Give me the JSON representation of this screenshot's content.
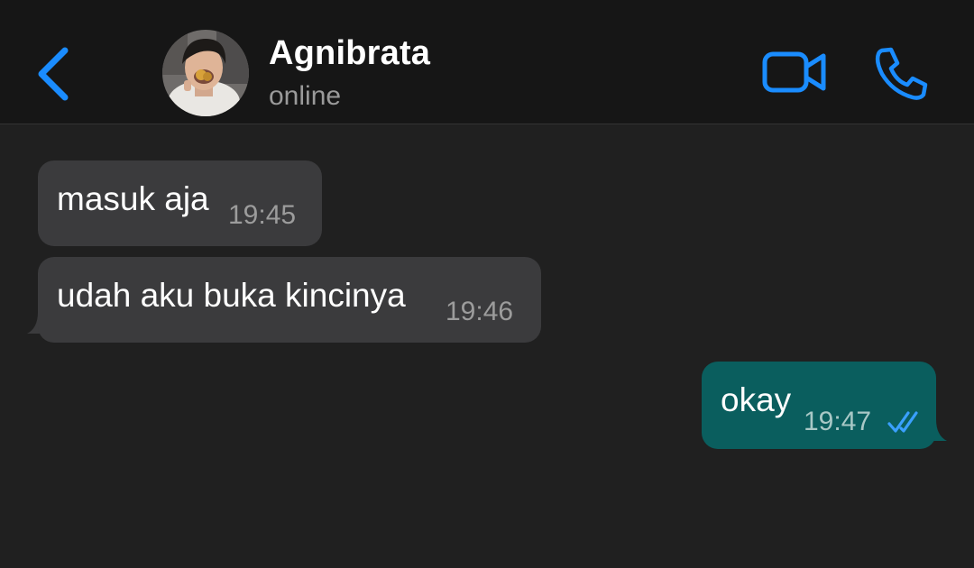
{
  "header": {
    "contact_name": "Agnibrata",
    "status": "online",
    "icons": [
      "chevron-left-icon",
      "avatar",
      "video-camera-icon",
      "phone-icon"
    ]
  },
  "messages": [
    {
      "direction": "incoming",
      "text": "masuk aja",
      "time": "19:45"
    },
    {
      "direction": "incoming",
      "text": "udah aku buka kincinya",
      "time": "19:46"
    },
    {
      "direction": "outgoing",
      "text": "okay",
      "time": "19:47",
      "receipt": "read-double-check-icon"
    }
  ],
  "colors": {
    "background": "#202020",
    "header_background": "#161616",
    "accent": "#1a8cff",
    "incoming_bubble": "#3b3b3d",
    "outgoing_bubble": "#0a5e5e",
    "read_receipt": "#3aa0ff"
  }
}
